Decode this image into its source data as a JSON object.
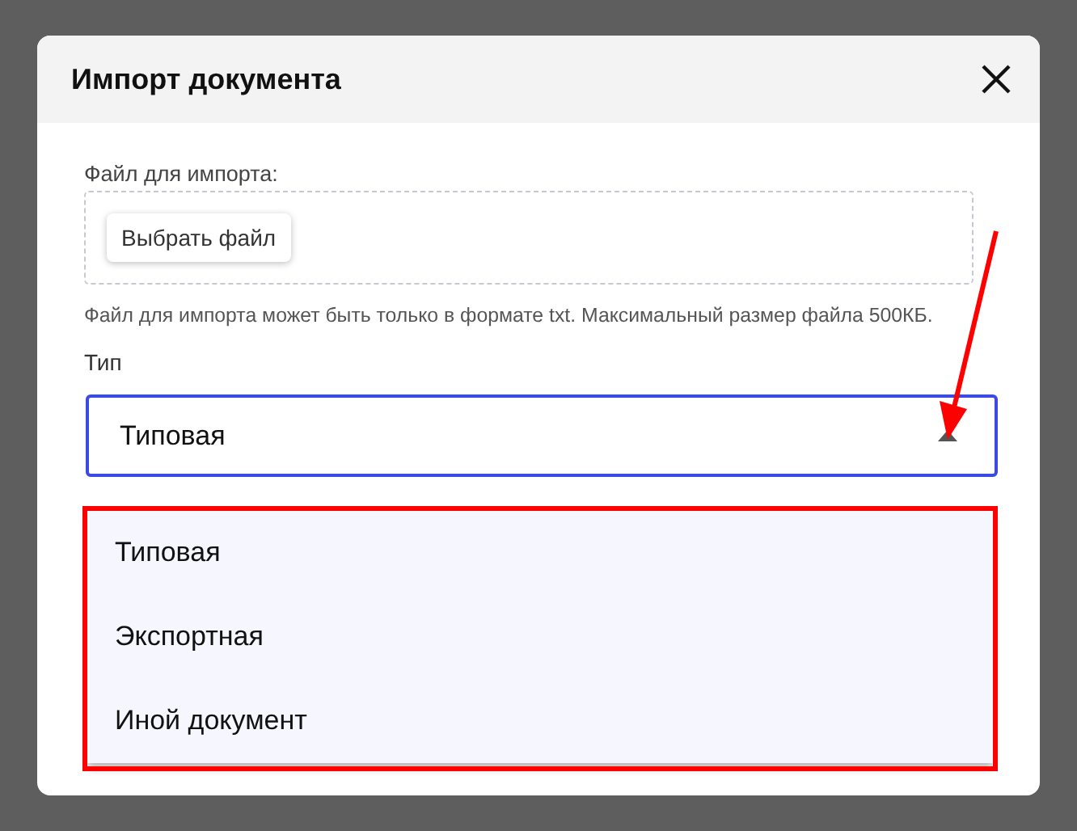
{
  "dialog": {
    "title": "Импорт документа",
    "file_field": {
      "label": "Файл для импорта:",
      "button": "Выбрать файл",
      "hint": "Файл для импорта может быть только в формате txt. Максимальный размер файла 500КБ."
    },
    "type_select": {
      "label": "Тип",
      "value": "Типовая",
      "expanded": true,
      "options": [
        {
          "label": "Типовая"
        },
        {
          "label": "Экспортная"
        },
        {
          "label": "Иной документ"
        }
      ]
    }
  }
}
